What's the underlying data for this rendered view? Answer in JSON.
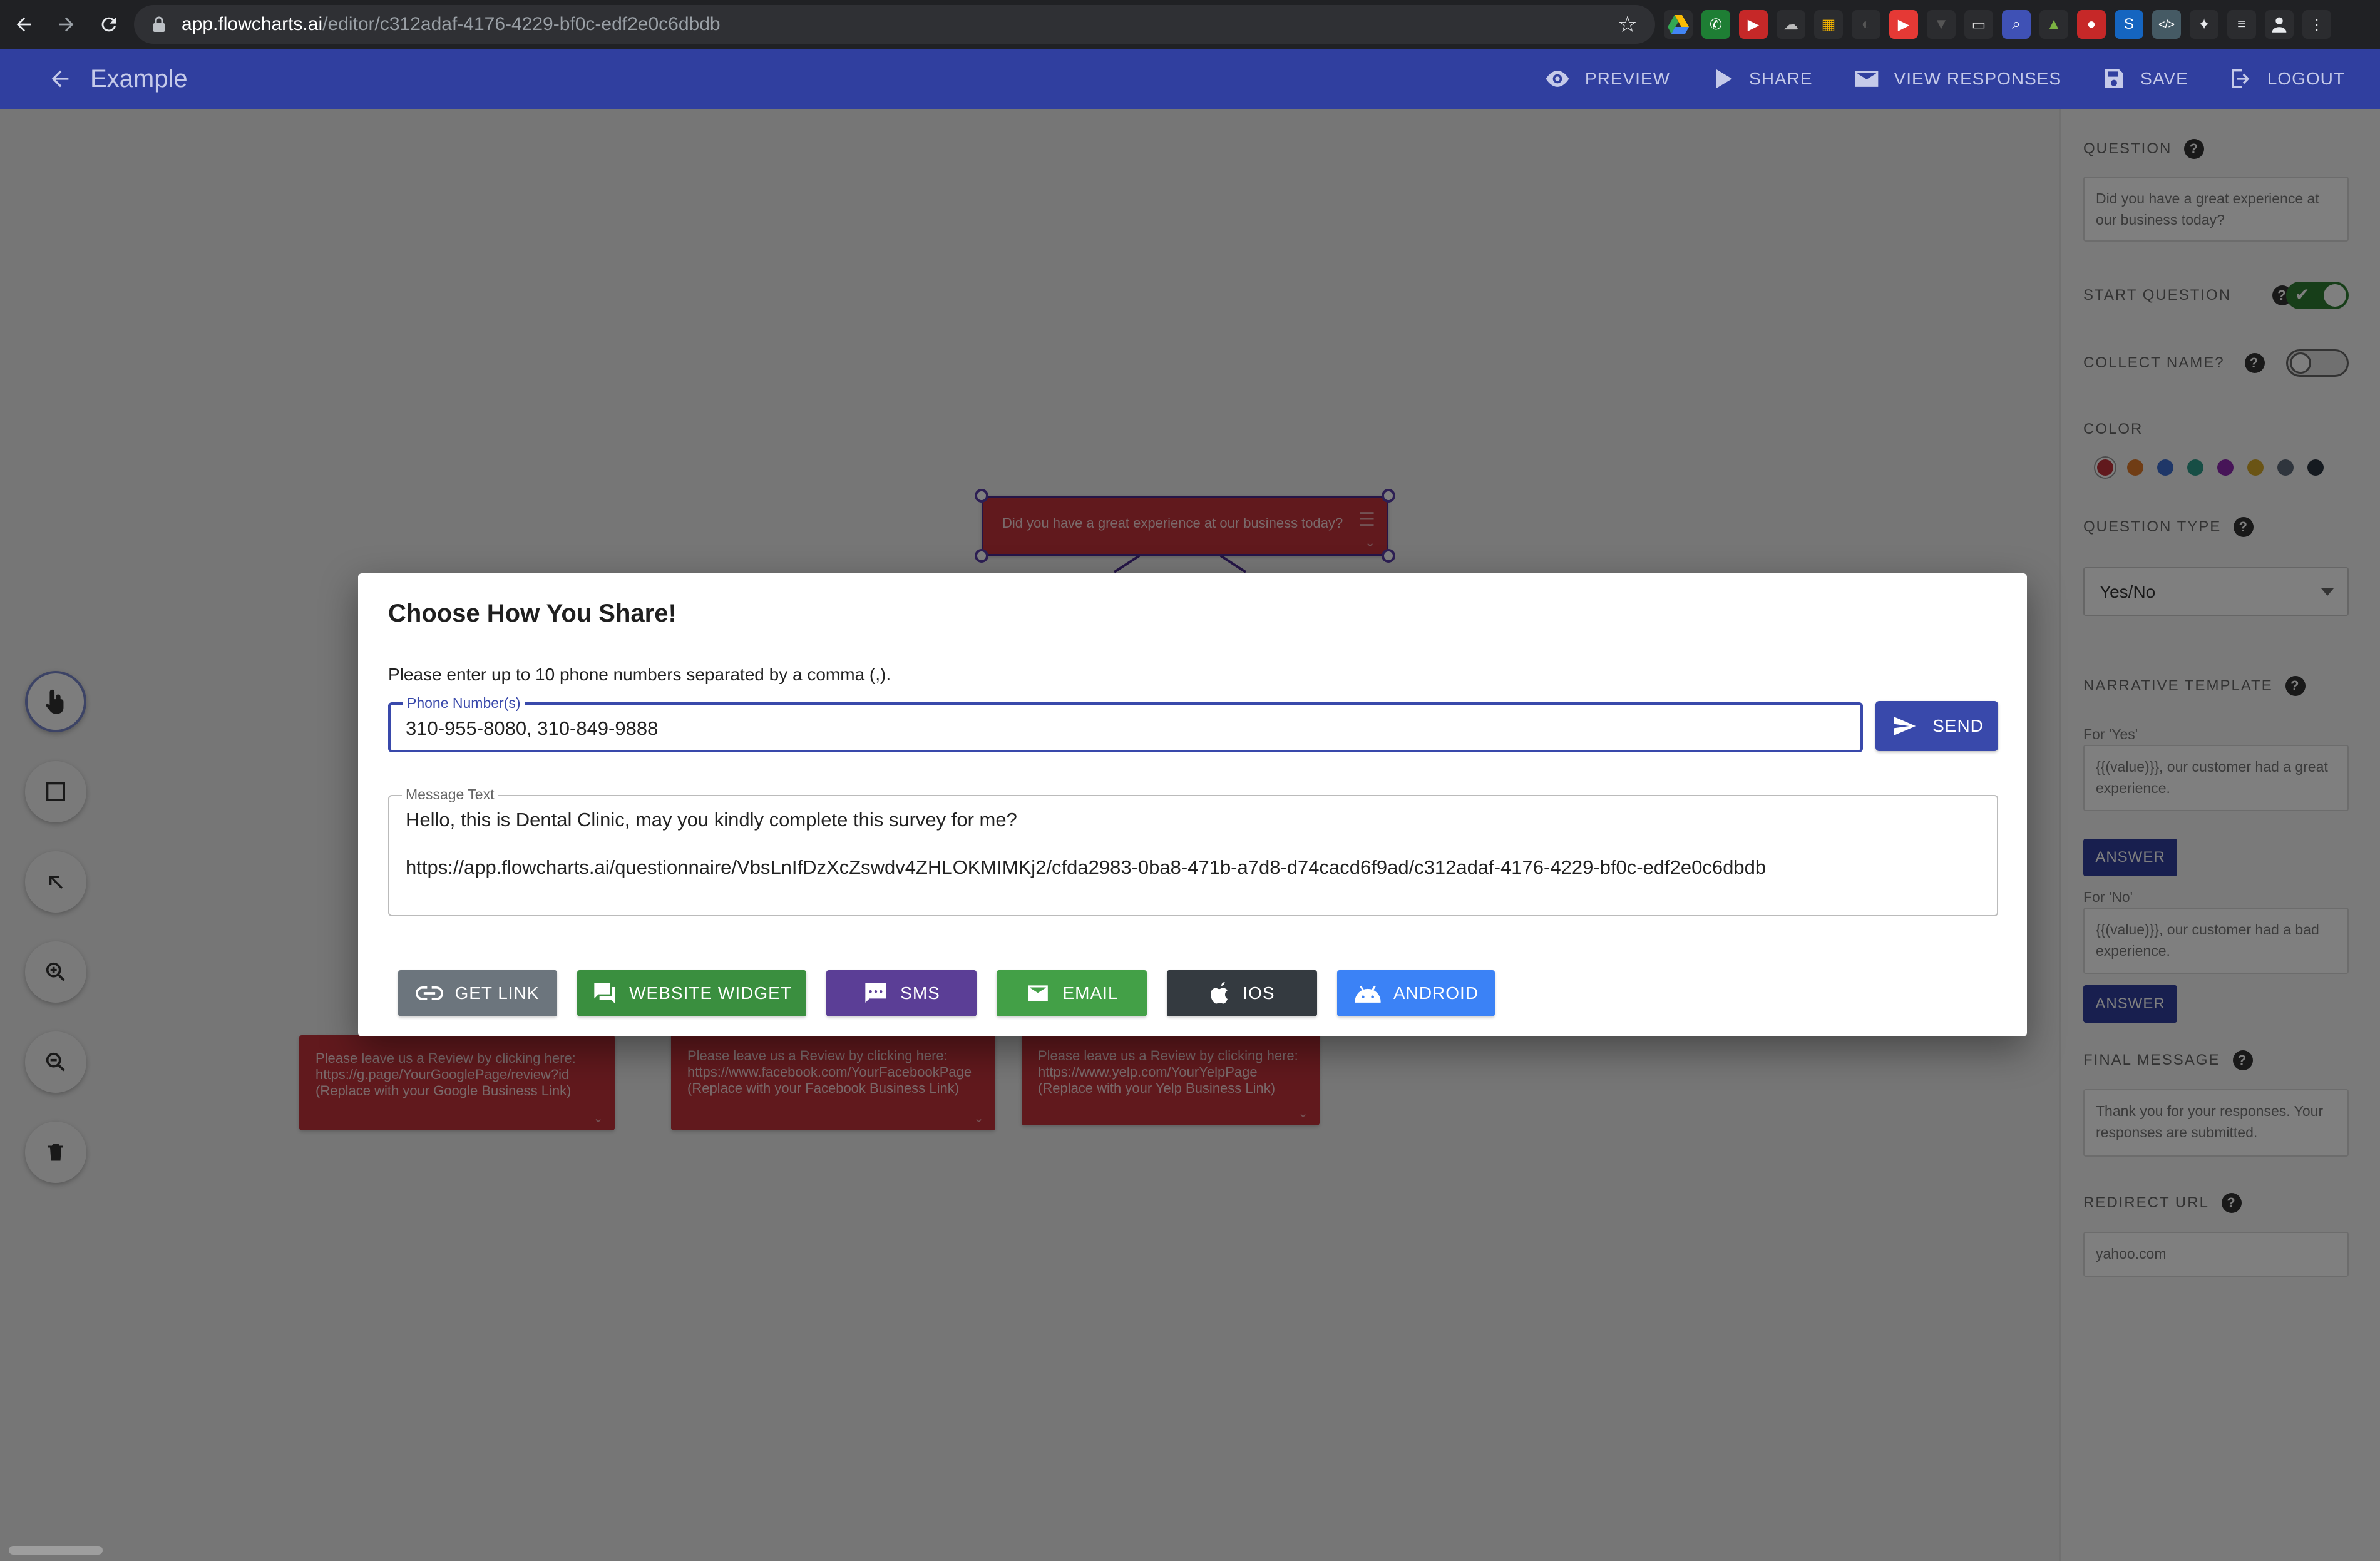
{
  "browser": {
    "url_host": "app.flowcharts.ai",
    "url_path": "/editor/c312adaf-4176-4229-bf0c-edf2e0c6dbdb"
  },
  "header": {
    "title": "Example",
    "actions": {
      "preview": "PREVIEW",
      "share": "SHARE",
      "view_responses": "VIEW RESPONSES",
      "save": "SAVE",
      "logout": "LOGOUT"
    }
  },
  "canvas": {
    "top_node": "Did you have a great experience at our business today?",
    "bottom_nodes": [
      "Please leave us a Review by clicking here: https://g.page/YourGooglePage/review?id (Replace with your Google Business Link)",
      "Please leave us a Review by clicking here: https://www.facebook.com/YourFacebookPage (Replace with your Facebook Business Link)",
      "Please leave us a Review by clicking here: https://www.yelp.com/YourYelpPage (Replace with your Yelp Business Link)"
    ]
  },
  "panel": {
    "question_label": "QUESTION",
    "question_value": "Did you have a great experience at our business today?",
    "start_question_label": "START QUESTION",
    "start_question_on": true,
    "collect_name_label": "COLLECT NAME?",
    "collect_name_on": false,
    "color_label": "COLOR",
    "colors": [
      "#c2323b",
      "#e07b2a",
      "#3f6fd1",
      "#2e9c8a",
      "#8e2bb0",
      "#d4a82a",
      "#5f6b7a",
      "#2b3440"
    ],
    "question_type_label": "QUESTION TYPE",
    "question_type_value": "Yes/No",
    "narrative_label": "NARRATIVE TEMPLATE",
    "for_yes_label": "For 'Yes'",
    "for_yes_value": "{{(value)}}, our customer had a great experience.",
    "for_no_label": "For 'No'",
    "for_no_value": "{{(value)}}, our customer had a bad experience.",
    "answer_label": "ANSWER",
    "final_message_label": "FINAL MESSAGE",
    "final_message_value": "Thank you for your responses. Your responses are submitted.",
    "redirect_label": "REDIRECT URL",
    "redirect_value": "yahoo.com"
  },
  "modal": {
    "title": "Choose How You Share!",
    "instruction": "Please enter up to 10 phone numbers separated by a comma (,).",
    "phone_label": "Phone Number(s)",
    "phone_value": "310-955-8080, 310-849-9888",
    "send_label": "SEND",
    "message_label": "Message Text",
    "message_line1": "Hello, this is Dental Clinic, may you kindly complete this survey for me?",
    "message_line2": "https://app.flowcharts.ai/questionnaire/VbsLnIfDzXcZswdv4ZHLOKMIMKj2/cfda2983-0ba8-471b-a7d8-d74cacd6f9ad/c312adaf-4176-4229-bf0c-edf2e0c6dbdb",
    "buttons": {
      "get_link": "GET LINK",
      "website_widget": "WEBSITE WIDGET",
      "sms": "SMS",
      "email": "EMAIL",
      "ios": "IOS",
      "android": "ANDROID"
    },
    "button_colors": {
      "get_link": "#6c757d",
      "website_widget": "#3a8f3f",
      "sms": "#5b3e96",
      "email": "#43a047",
      "ios": "#343a40",
      "android": "#3b82f6"
    }
  }
}
